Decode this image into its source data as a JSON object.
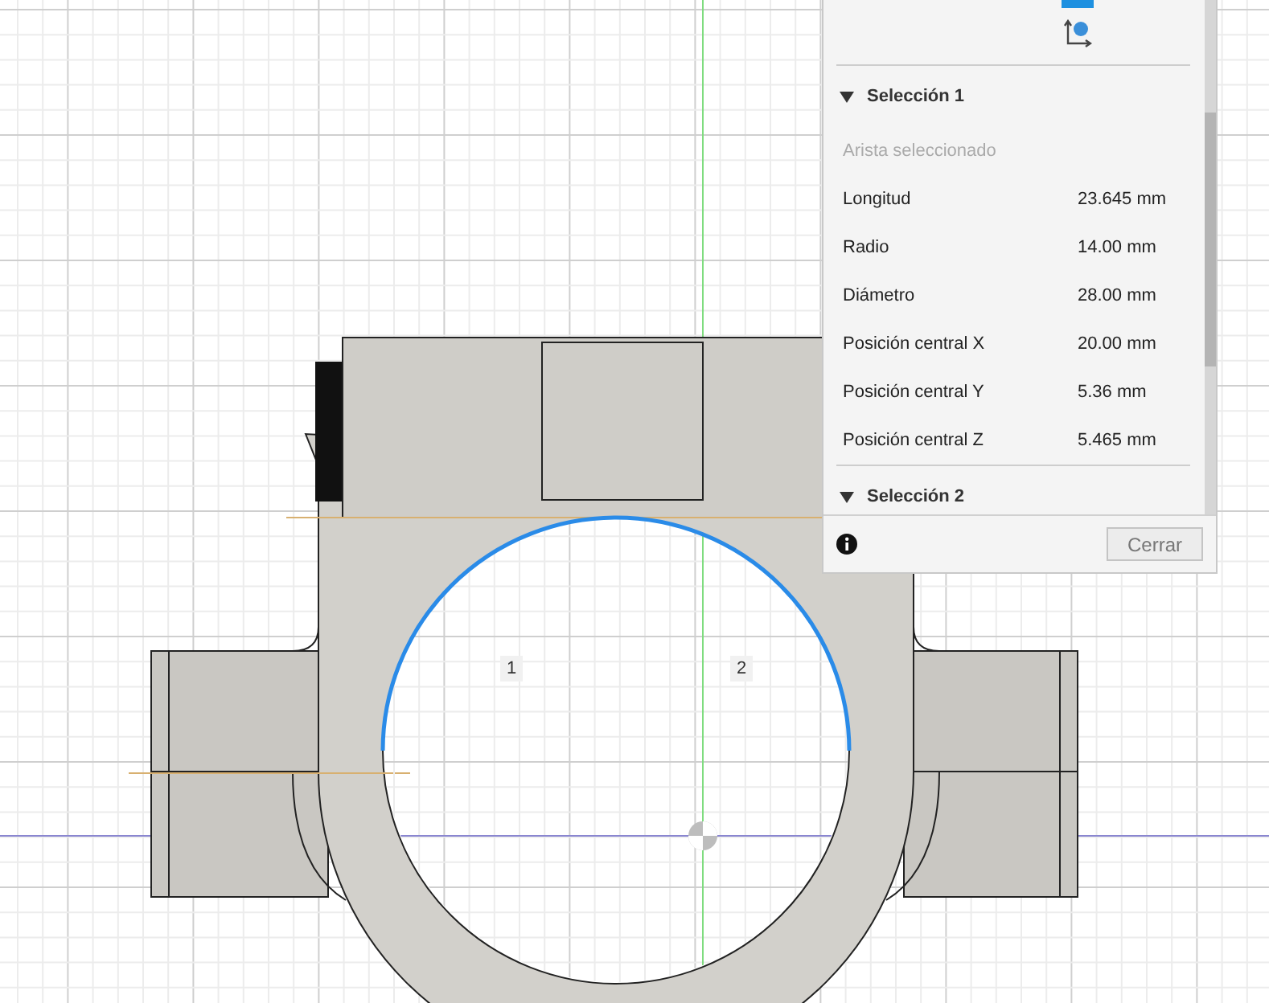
{
  "viewport": {
    "markers": [
      {
        "label": "1"
      },
      {
        "label": "2"
      }
    ]
  },
  "panel": {
    "sections": [
      {
        "title": "Selección 1",
        "subtitle": "Arista seleccionado",
        "rows": [
          {
            "label": "Longitud",
            "value": "23.645 mm"
          },
          {
            "label": "Radio",
            "value": "14.00 mm"
          },
          {
            "label": "Diámetro",
            "value": "28.00 mm"
          },
          {
            "label": "Posición central X",
            "value": "20.00 mm"
          },
          {
            "label": "Posición central Y",
            "value": "5.36 mm"
          },
          {
            "label": "Posición central Z",
            "value": "5.465 mm"
          }
        ]
      },
      {
        "title": "Selección 2"
      }
    ],
    "close_button": "Cerrar"
  }
}
